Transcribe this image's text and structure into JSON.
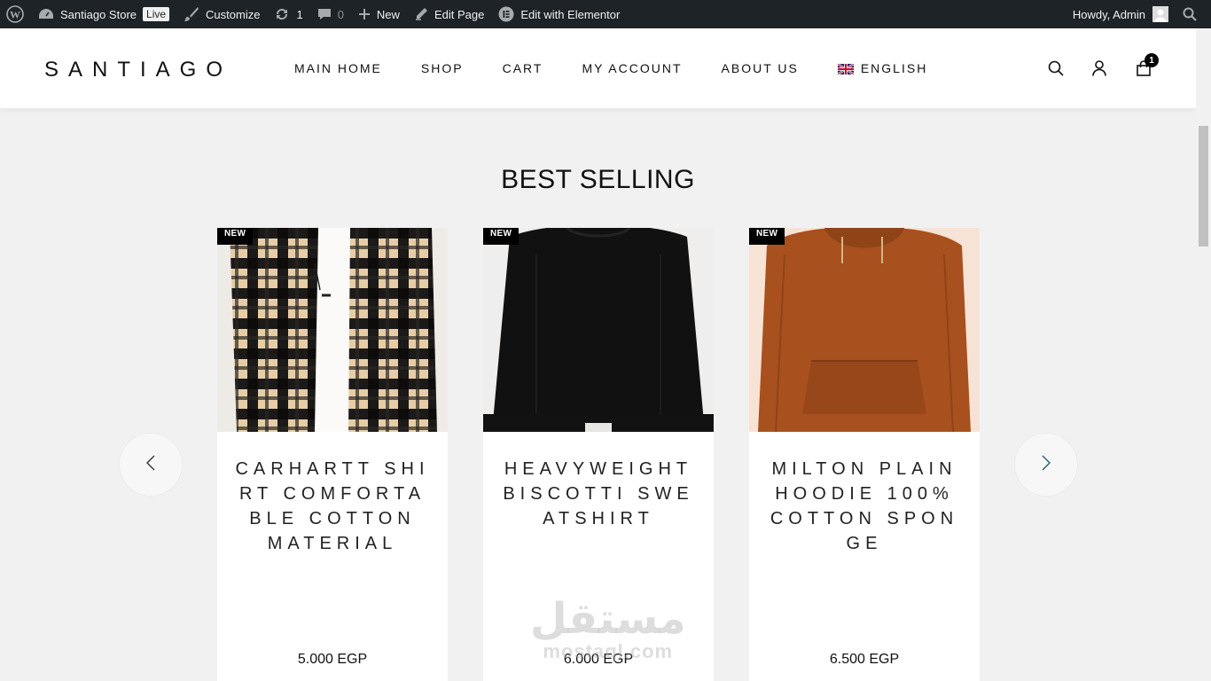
{
  "admin_bar": {
    "site_name": "Santiago Store",
    "live_badge": "Live",
    "customize": "Customize",
    "updates_count": "1",
    "comments_count": "0",
    "new": "New",
    "edit_page": "Edit Page",
    "edit_elementor": "Edit with Elementor",
    "howdy": "Howdy, Admin"
  },
  "header": {
    "logo": "SANTIAGO",
    "nav": [
      "MAIN HOME",
      "SHOP",
      "CART",
      "MY ACCOUNT",
      "ABOUT US"
    ],
    "language": "ENGLISH",
    "cart_count": "1"
  },
  "section": {
    "title": "BEST SELLING"
  },
  "products": [
    {
      "badge": "NEW",
      "title": "CARHARTT SHIRT COMFORTABLE COTTON MATERIAL",
      "price": "5.000 EGP"
    },
    {
      "badge": "NEW",
      "title": "HEAVYWEIGHT BISCOTTI SWEATSHIRT",
      "price": "6.000 EGP"
    },
    {
      "badge": "NEW",
      "title": "MILTON PLAIN HOODIE 100% COTTON SPONGE",
      "price": "6.500 EGP"
    }
  ],
  "watermark": {
    "arabic": "مستقل",
    "latin": "mostaql.com"
  },
  "colors": {
    "admin_bar_bg": "#1d2327",
    "page_bg": "#f1f1f1",
    "accent": "#000000"
  }
}
